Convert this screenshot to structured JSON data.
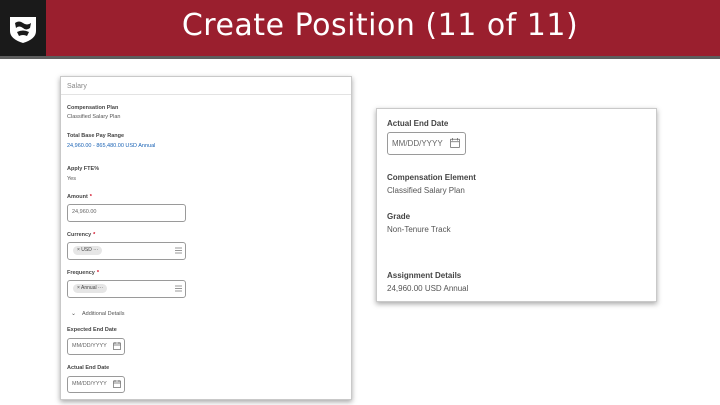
{
  "slide": {
    "title": "Create Position (11 of 11)"
  },
  "left_panel": {
    "section": "Salary",
    "compensation_plan": {
      "label": "Compensation Plan",
      "value": "Classified Salary Plan"
    },
    "pay_range": {
      "label": "Total Base Pay Range",
      "value": "24,960.00 - 865,480.00 USD Annual"
    },
    "apply_fte": {
      "label": "Apply FTE%",
      "value": "Yes"
    },
    "amount": {
      "label": "Amount",
      "required": "*",
      "value": "24,960.00"
    },
    "currency": {
      "label": "Currency",
      "required": "*",
      "pill": "×  USD  ···"
    },
    "frequency": {
      "label": "Frequency",
      "required": "*",
      "pill": "×  Annual  ···"
    },
    "additional": {
      "toggle": "⌄",
      "label": "Additional Details"
    },
    "expected_end": {
      "label": "Expected End Date",
      "placeholder": "MM/DD/YYYY"
    },
    "actual_end": {
      "label": "Actual End Date",
      "placeholder": "MM/DD/YYYY"
    }
  },
  "right_panel": {
    "actual_end": {
      "label": "Actual End Date",
      "placeholder": "MM/DD/YYYY"
    },
    "comp_element": {
      "label": "Compensation Element",
      "value": "Classified Salary Plan"
    },
    "grade": {
      "label": "Grade",
      "value": "Non-Tenure Track"
    },
    "assignment": {
      "label": "Assignment Details",
      "value": "24,960.00 USD Annual"
    }
  },
  "icons": {
    "logo": "wsu-cougar-logo",
    "calendar": "calendar-icon",
    "menu": "list-menu-icon"
  },
  "colors": {
    "banner": "#9a1f2e",
    "link": "#1a63b5",
    "required": "#d0021b"
  }
}
